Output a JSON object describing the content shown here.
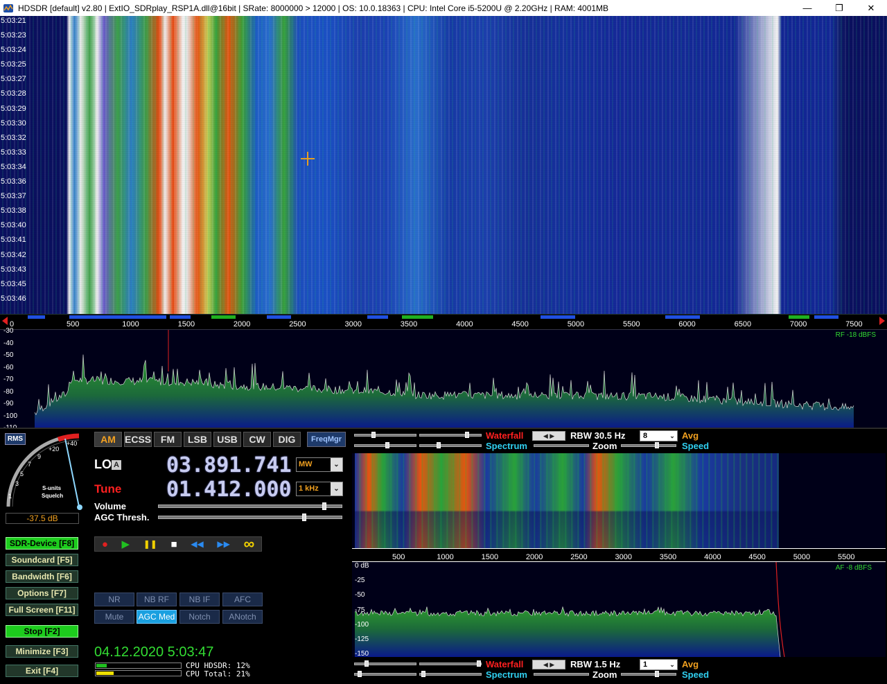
{
  "window": {
    "title": "HDSDR  [default]  v2.80  |  ExtIO_SDRplay_RSP1A.dll@16bit  |  SRate: 8000000 > 12000  |  OS: 10.0.18363  |  CPU: Intel Core i5-5200U @ 2.20GHz  |  RAM: 4001MB",
    "minimize": "—",
    "maximize": "❐",
    "close": "✕"
  },
  "waterfall": {
    "timestamps": [
      "5:03:21",
      "5:03:23",
      "5:03:24",
      "5:03:25",
      "5:03:27",
      "5:03:28",
      "5:03:29",
      "5:03:30",
      "5:03:32",
      "5:03:33",
      "5:03:34",
      "5:03:36",
      "5:03:37",
      "5:03:38",
      "5:03:40",
      "5:03:41",
      "5:03:42",
      "5:03:43",
      "5:03:45",
      "5:03:46"
    ]
  },
  "freq_scale": {
    "labels": [
      "0",
      "500",
      "1000",
      "1500",
      "2000",
      "2500",
      "3000",
      "3500",
      "4000",
      "4500",
      "5000",
      "5500",
      "6000",
      "6500",
      "7000",
      "7500"
    ]
  },
  "spectrum": {
    "db_labels": [
      "-30",
      "-40",
      "-50",
      "-60",
      "-70",
      "-80",
      "-90",
      "-100",
      "-110"
    ],
    "rf_level": "RF -18 dBFS"
  },
  "smeter": {
    "rms_label": "RMS",
    "scale_labels": [
      "1",
      "3",
      "5",
      "7",
      "9",
      "+20",
      "+40"
    ],
    "caption_1": "S-units",
    "caption_2": "Squelch",
    "db_readout": "-37.5 dB"
  },
  "side_buttons": {
    "sdr_device": "SDR-Device [F8]",
    "soundcard": "Soundcard  [F5]",
    "bandwidth": "Bandwidth  [F6]",
    "options": "Options    [F7]",
    "full_screen": "Full Screen [F11]",
    "stop": "Stop       [F2]",
    "minimize": "Minimize  [F3]",
    "exit": "Exit       [F4]"
  },
  "modes": {
    "am": "AM",
    "ecss": "ECSS",
    "fm": "FM",
    "lsb": "LSB",
    "usb": "USB",
    "cw": "CW",
    "dig": "DIG",
    "freqmgr": "FreqMgr"
  },
  "tuning": {
    "lo_label": "LO",
    "lo_badge": "A",
    "lo_freq": "03.891.741",
    "lo_band": "MW",
    "tune_label": "Tune",
    "tune_freq": "01.412.000",
    "tune_step": "1 kHz",
    "volume_label": "Volume",
    "volume_level": 0.91,
    "agc_label": "AGC Thresh.",
    "agc_level": 0.8
  },
  "transport": {
    "record": "●",
    "play": "▶",
    "pause": "❚❚",
    "stop": "■",
    "rewind": "◀◀",
    "forward": "▶▶",
    "loop": "∞"
  },
  "dsp": {
    "nr": "NR",
    "nb_rf": "NB RF",
    "nb_if": "NB IF",
    "afc": "AFC",
    "mute": "Mute",
    "agc_med": "AGC Med",
    "notch": "Notch",
    "anotch": "ANotch"
  },
  "status": {
    "datetime": "04.12.2020 5:03:47",
    "cpu_hdsdr": "CPU HDSDR: 12%",
    "cpu_total": "CPU Total: 21%",
    "cpu_hdsdr_level": 0.12,
    "cpu_total_level": 0.21
  },
  "af_top_toolbar": {
    "waterfall": "Waterfall",
    "spectrum": "Spectrum",
    "rbw": "RBW 30.5 Hz",
    "zoom": "Zoom",
    "avg_value": "8",
    "avg": "Avg",
    "speed": "Speed"
  },
  "af_scale": {
    "labels": [
      "500",
      "1000",
      "1500",
      "2000",
      "2500",
      "3000",
      "3500",
      "4000",
      "4500",
      "5000",
      "5500"
    ]
  },
  "af_spectrum": {
    "db_labels": [
      "0 dB",
      "-25",
      "-50",
      "-75",
      "-100",
      "-125",
      "-150"
    ],
    "af_level": "AF  -8 dBFS"
  },
  "af_bottom_toolbar": {
    "waterfall": "Waterfall",
    "spectrum": "Spectrum",
    "rbw": "RBW  1.5 Hz",
    "zoom": "Zoom",
    "avg_value": "1",
    "avg": "Avg",
    "speed": "Speed"
  },
  "colors": {
    "accent_orange": "#f2a020",
    "tune_red": "#ff2020",
    "status_green": "#33dd33",
    "avg_orange": "#f0a020",
    "speed_cyan": "#30d0f0"
  }
}
